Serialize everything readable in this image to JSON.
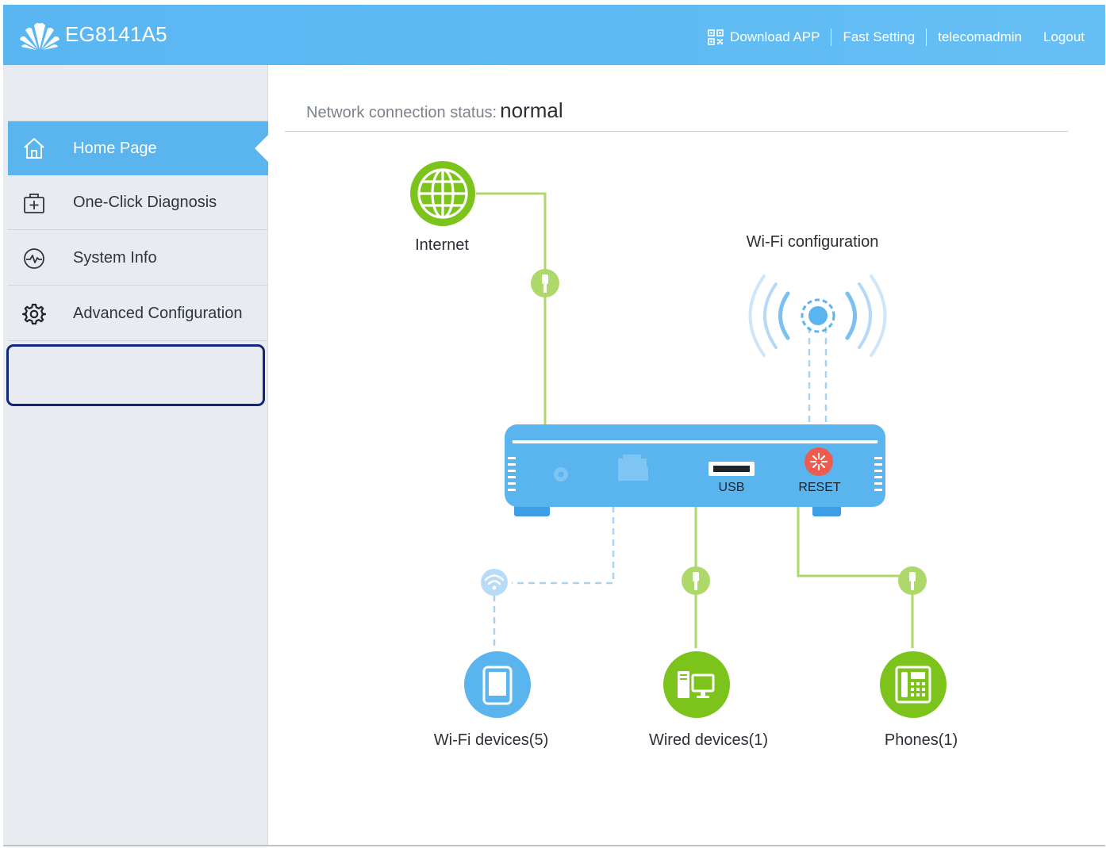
{
  "header": {
    "model": "EG8141A5",
    "links": {
      "download_app": "Download APP",
      "fast_setting": "Fast Setting",
      "user": "telecomadmin",
      "logout": "Logout"
    }
  },
  "sidebar": {
    "items": [
      {
        "label": "Home Page",
        "icon": "home-icon",
        "active": true
      },
      {
        "label": "One-Click Diagnosis",
        "icon": "first-aid-kit-icon",
        "active": false
      },
      {
        "label": "System Info",
        "icon": "pulse-icon",
        "active": false
      },
      {
        "label": "Advanced Configuration",
        "icon": "gear-icon",
        "active": false,
        "highlighted": true
      }
    ]
  },
  "main": {
    "status_label": "Network connection status:",
    "status_value": "normal",
    "topology": {
      "internet": "Internet",
      "wifi_config": "Wi-Fi configuration",
      "usb": "USB",
      "reset": "RESET",
      "wifi_devices": "Wi-Fi devices(5)",
      "wired_devices": "Wired devices(1)",
      "phones": "Phones(1)"
    }
  },
  "colors": {
    "header_blue": "#5ab6f1",
    "sidebar_bg": "#e8ebef",
    "active_blue": "#5ab4ee",
    "device_blue": "#5ab4ee",
    "green": "#7cc41b",
    "line_green": "#aed96a",
    "reset_red": "#ee5b4f",
    "highlight_navy": "#13277a"
  }
}
